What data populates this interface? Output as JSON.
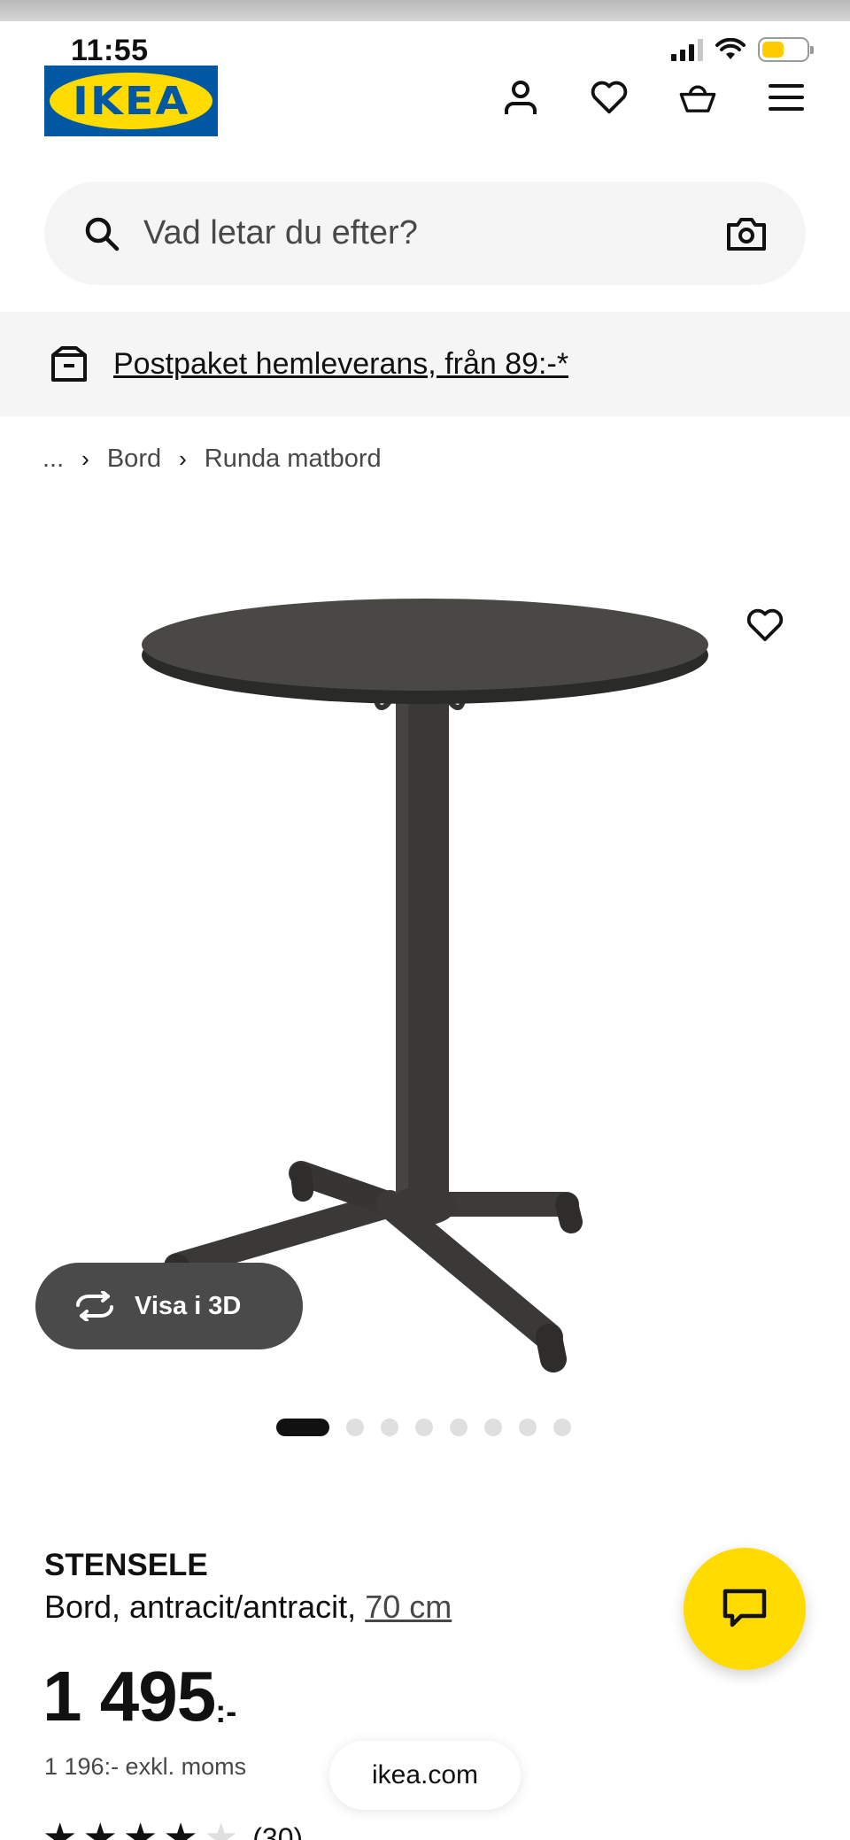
{
  "status_bar": {
    "time": "11:55"
  },
  "brand": {
    "logo_text": "IKEA",
    "blue": "#0058a3",
    "yellow": "#ffdb00"
  },
  "header": {
    "icons": [
      "user-icon",
      "heart-icon",
      "basket-icon",
      "menu-icon"
    ]
  },
  "search": {
    "placeholder": "Vad letar du efter?"
  },
  "banner": {
    "text": "Postpaket hemleverans, från 89:-*"
  },
  "breadcrumb": {
    "first": "...",
    "items": [
      "Bord",
      "Runda matbord"
    ]
  },
  "gallery": {
    "view3d_label": "Visa i 3D",
    "image_count": 8,
    "current_index": 1
  },
  "product": {
    "name": "STENSELE",
    "description": "Bord, antracit/antracit,",
    "size_link": "70 cm",
    "price": "1 495",
    "price_suffix": ":-",
    "price_ex_vat": "1 196:- exkl. moms",
    "rating": 4,
    "rating_max": 5,
    "review_count": "(30)"
  },
  "browser": {
    "url": "ikea.com"
  },
  "colors": {
    "chat_button": "#ffdb00",
    "text": "#111111",
    "muted": "#484848",
    "surface": "#f5f5f5"
  }
}
